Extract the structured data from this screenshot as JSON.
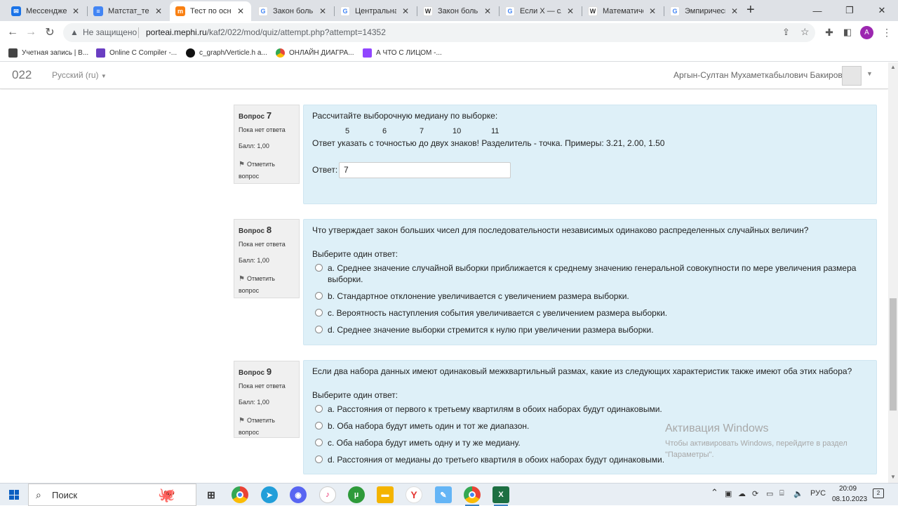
{
  "browser": {
    "tabs": [
      {
        "title": "Мессенджер",
        "icon": "messenger-icon",
        "color": "#1a73e8",
        "active": false
      },
      {
        "title": "Матстат_тест",
        "icon": "docs-icon",
        "color": "#4285f4",
        "active": false
      },
      {
        "title": "Тест по основ",
        "icon": "moodle-icon",
        "color": "#f98012",
        "active": true
      },
      {
        "title": "Закон больш",
        "icon": "google-icon",
        "color": "#4285f4",
        "active": false
      },
      {
        "title": "Центральная",
        "icon": "google-icon",
        "color": "#4285f4",
        "active": false
      },
      {
        "title": "Закон больш",
        "icon": "wikipedia-icon",
        "color": "#333333",
        "active": false
      },
      {
        "title": "Если X — слу",
        "icon": "google-icon",
        "color": "#4285f4",
        "active": false
      },
      {
        "title": "Математиче",
        "icon": "wikipedia-icon",
        "color": "#333333",
        "active": false
      },
      {
        "title": "Эмпирическ",
        "icon": "google-icon",
        "color": "#4285f4",
        "active": false
      }
    ],
    "new_tab": "+",
    "address": {
      "insecure_label": "Не защищено",
      "host": "porteai.mephi.ru",
      "path": "/kaf2/022/mod/quiz/attempt.php?attempt=14352"
    },
    "profile_initial": "A",
    "bookmarks": [
      {
        "label": "Учетная запись | В...",
        "icon": "shield-icon",
        "color": "#444444"
      },
      {
        "label": "Online C Compiler -...",
        "icon": "compiler-icon",
        "color": "#6a3ec2"
      },
      {
        "label": "c_graph/Verticle.h a...",
        "icon": "github-icon",
        "color": "#111111"
      },
      {
        "label": "ОНЛАЙН ДИАГРА...",
        "icon": "chart-icon",
        "color": "#e8453c"
      },
      {
        "label": "А ЧТО С ЛИЦОМ -...",
        "icon": "twitch-icon",
        "color": "#9146ff"
      }
    ]
  },
  "moodle": {
    "site_name": "022",
    "language": "Русский (ru)",
    "user_name": "Аргын-Султан Мухаметкабылович Бакиров"
  },
  "questions": [
    {
      "label": "Вопрос",
      "number": "7",
      "status": "Пока нет ответа",
      "grade": "Балл: 1,00",
      "flag_line1": "Отметить",
      "flag_line2": "вопрос",
      "text": "Рассчитайте выборочную медиану по выборке:",
      "sample": [
        "5",
        "6",
        "7",
        "10",
        "11"
      ],
      "note": "Ответ указать с точностью до двух знаков! Разделитель - точка. Примеры: 3.21, 2.00, 1.50",
      "answer_label": "Ответ:",
      "answer_value": "7"
    },
    {
      "label": "Вопрос",
      "number": "8",
      "status": "Пока нет ответа",
      "grade": "Балл: 1,00",
      "flag_line1": "Отметить",
      "flag_line2": "вопрос",
      "text": "Что утверждает закон больших чисел для последовательности независимых одинаково распределенных случайных величин?",
      "prompt": "Выберите один ответ:",
      "options": [
        {
          "line1": "a. Среднее значение случайной выборки приближается к среднему значению генеральной совокупности по мере увеличения размера",
          "line2": "выборки."
        },
        {
          "line1": "b. Стандартное отклонение увеличивается с увеличением размера выборки."
        },
        {
          "line1": "c. Вероятность наступления события увеличивается с увеличением размера выборки."
        },
        {
          "line1": "d. Среднее значение выборки стремится к нулю при увеличении размера выборки."
        }
      ]
    },
    {
      "label": "Вопрос",
      "number": "9",
      "status": "Пока нет ответа",
      "grade": "Балл: 1,00",
      "flag_line1": "Отметить",
      "flag_line2": "вопрос",
      "text": "Если два набора данных имеют одинаковый межквартильный размах, какие из следующих характеристик также имеют оба этих набора?",
      "prompt": "Выберите один ответ:",
      "options": [
        {
          "line1": "a. Расстояния от первого к третьему квартилям в обоих наборах будут одинаковыми."
        },
        {
          "line1": "b. Оба набора будут иметь один и тот же диапазон."
        },
        {
          "line1": "c. Оба набора будут иметь одну и ту же медиану."
        },
        {
          "line1": "d. Расстояния от медианы до третьего квартиля в обоих наборах будут одинаковыми."
        }
      ]
    }
  ],
  "watermark": {
    "title": "Активация Windows",
    "line1": "Чтобы активировать Windows, перейдите в раздел",
    "line2": "\"Параметры\"."
  },
  "taskbar": {
    "search_label": "Поиск",
    "language": "РУС",
    "time": "20:09",
    "date": "08.10.2023",
    "notifications": "2"
  }
}
